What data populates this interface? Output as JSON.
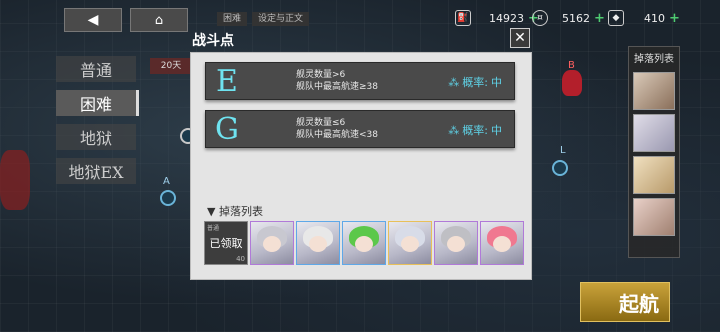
{
  "top": {
    "back_icon": "back-arrow-icon",
    "home_icon": "home-icon",
    "tab1": "困难",
    "tab2": "设定与正文"
  },
  "resources": [
    {
      "name": "fuel",
      "value": "14923",
      "icon": "fuel-icon"
    },
    {
      "name": "coin",
      "value": "5162",
      "icon": "coin-icon"
    },
    {
      "name": "diamond",
      "value": "410",
      "icon": "diamond-icon"
    }
  ],
  "difficulties": [
    "普通",
    "困难",
    "地狱",
    "地狱EX"
  ],
  "selected_difficulty": "困难",
  "behind_tag": "20天",
  "map_nodes": [
    "A",
    "L",
    "B"
  ],
  "right_panel": {
    "title": "掉落列表"
  },
  "sortie_label": "起航",
  "modal": {
    "title": "战斗点",
    "close_icon": "close-icon",
    "routes": [
      {
        "letter": "E",
        "cond1": "舰灵数量>6",
        "cond2": "舰队中最高航速≥38",
        "rate_label": "概率:",
        "rate_value": "中"
      },
      {
        "letter": "G",
        "cond1": "舰灵数量≤6",
        "cond2": "舰队中最高航速<38",
        "rate_label": "概率:",
        "rate_value": "中"
      }
    ],
    "drop_title": "▼ 掉落列表",
    "claimed": {
      "tag": "普通",
      "label": "已领取",
      "count": "40"
    }
  },
  "colors": {
    "accent": "#6fe3f0",
    "rate": "#5fd3e8",
    "sortie": "#c9a23a"
  }
}
